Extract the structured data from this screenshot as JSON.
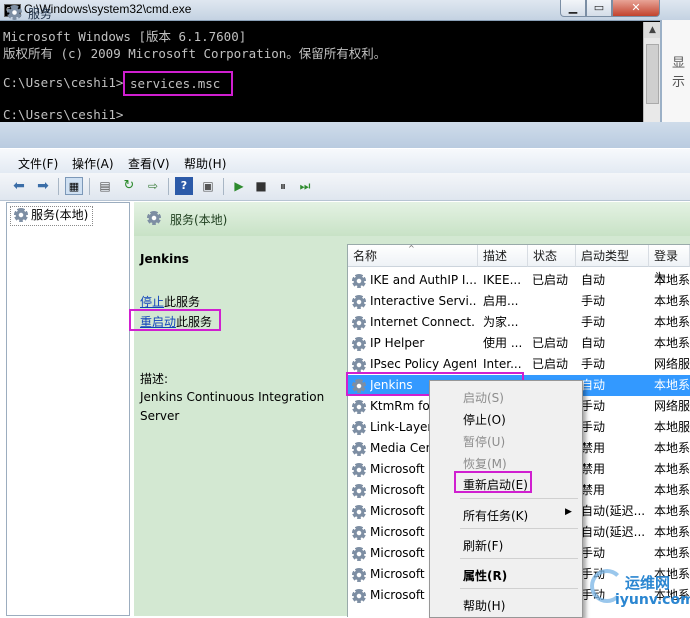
{
  "cmd": {
    "title": "C:\\Windows\\system32\\cmd.exe",
    "icon_label": "C:\\",
    "lines": [
      "Microsoft Windows [版本 6.1.7600]",
      "版权所有 (c) 2009 Microsoft Corporation。保留所有权利。",
      "",
      "C:\\Users\\ceshi1>",
      "",
      "C:\\Users\\ceshi1>"
    ],
    "command": "services.msc",
    "side_text": "显示"
  },
  "services": {
    "title": "服务",
    "menu": [
      "文件(F)",
      "操作(A)",
      "查看(V)",
      "帮助(H)"
    ],
    "tree_item": "服务(本地)",
    "header": "服务(本地)",
    "detail": {
      "name": "Jenkins",
      "stop_link": "停止",
      "stop_suffix": "此服务",
      "restart_link": "重启动",
      "restart_suffix": "此服务",
      "desc_label": "描述:",
      "desc_text": "Jenkins Continuous Integration Server"
    },
    "columns": [
      "名称",
      "描述",
      "状态",
      "启动类型",
      "登录为"
    ],
    "rows": [
      {
        "name": "IKE and AuthIP I...",
        "desc": "IKEE...",
        "status": "已启动",
        "startup": "自动",
        "logon": "本地系"
      },
      {
        "name": "Interactive Servi...",
        "desc": "启用...",
        "status": "",
        "startup": "手动",
        "logon": "本地系"
      },
      {
        "name": "Internet Connect...",
        "desc": "为家...",
        "status": "",
        "startup": "手动",
        "logon": "本地系"
      },
      {
        "name": "IP Helper",
        "desc": "使用 ...",
        "status": "已启动",
        "startup": "自动",
        "logon": "本地系"
      },
      {
        "name": "IPsec Policy Agent",
        "desc": "Inter...",
        "status": "已启动",
        "startup": "手动",
        "logon": "网络服"
      },
      {
        "name": "Jenkins",
        "desc": "",
        "status": "",
        "startup": "自动",
        "logon": "本地系"
      },
      {
        "name": "KtmRm fo",
        "desc": "",
        "status": "",
        "startup": "手动",
        "logon": "网络服"
      },
      {
        "name": "Link-Layer",
        "desc": "",
        "status": "",
        "startup": "手动",
        "logon": "本地服"
      },
      {
        "name": "Media Cen",
        "desc": "",
        "status": "",
        "startup": "禁用",
        "logon": "本地系"
      },
      {
        "name": "Microsoft",
        "desc": "",
        "status": "",
        "startup": "禁用",
        "logon": "本地系"
      },
      {
        "name": "Microsoft",
        "desc": "",
        "status": "",
        "startup": "禁用",
        "logon": "本地系"
      },
      {
        "name": "Microsoft",
        "desc": "",
        "status": "",
        "startup": "自动(延迟...",
        "logon": "本地系"
      },
      {
        "name": "Microsoft",
        "desc": "",
        "status": "",
        "startup": "自动(延迟...",
        "logon": "本地系"
      },
      {
        "name": "Microsoft",
        "desc": "",
        "status": "",
        "startup": "手动",
        "logon": "本地系"
      },
      {
        "name": "Microsoft",
        "desc": "",
        "status": "",
        "startup": "手动",
        "logon": "本地系"
      },
      {
        "name": "Microsoft",
        "desc": "",
        "status": "",
        "startup": "手动",
        "logon": "本地系"
      }
    ],
    "context_menu": {
      "start": "启动(S)",
      "stop": "停止(O)",
      "pause": "暂停(U)",
      "resume": "恢复(M)",
      "restart": "重新启动(E)",
      "all_tasks": "所有任务(K)",
      "refresh": "刷新(F)",
      "properties": "属性(R)",
      "help": "帮助(H)"
    }
  },
  "watermark": {
    "cn": "运维网",
    "en": "iyunv.com"
  },
  "colors": {
    "highlight_box": "#d01fd0",
    "selection": "#3399ff",
    "detail_bg": "#d3e8d2",
    "link": "#1144bb"
  }
}
